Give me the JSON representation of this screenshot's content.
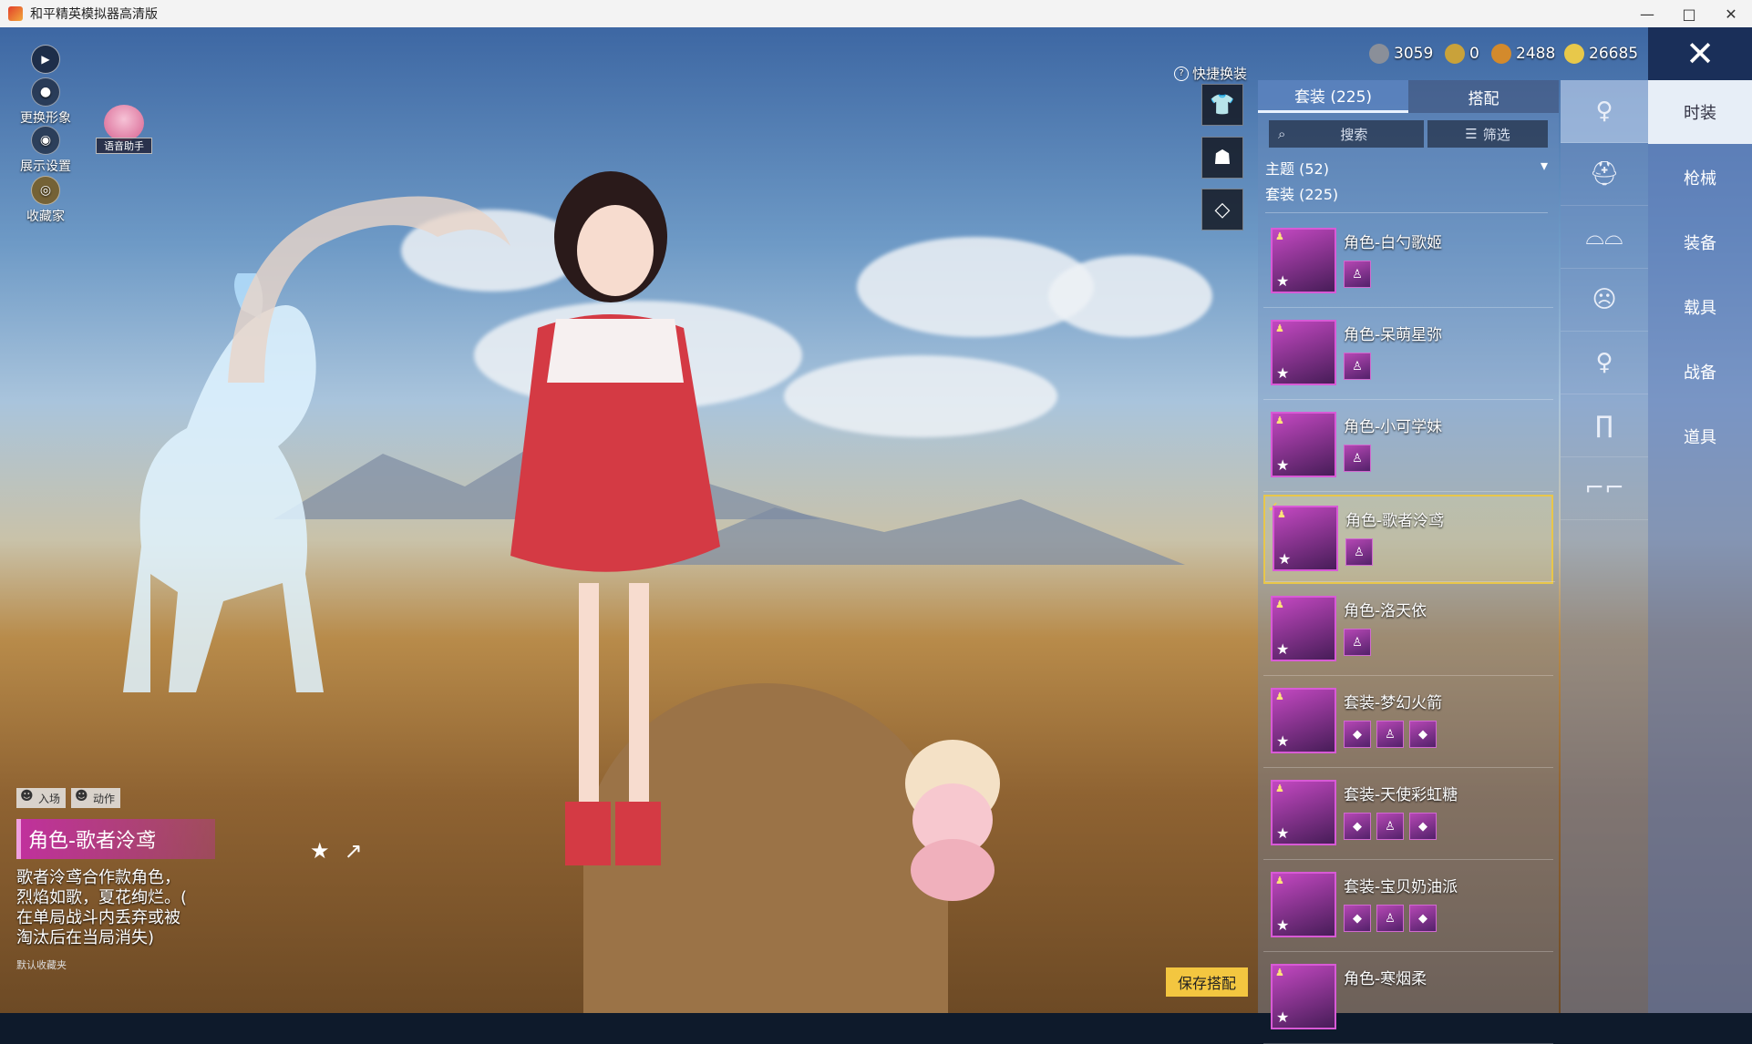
{
  "window": {
    "title": "和平精英模拟器高清版",
    "minimize": "—",
    "maximize": "□",
    "close": "✕"
  },
  "left_menu": {
    "change_look": "更换形象",
    "display_settings": "展示设置",
    "collector": "收藏家",
    "voice_assistant": "语音助手"
  },
  "currencies": [
    {
      "value": "3059",
      "color": "#8a8f99"
    },
    {
      "value": "0",
      "color": "#c9a23a"
    },
    {
      "value": "2488",
      "color": "#d38a2c"
    },
    {
      "value": "26685",
      "color": "#e8c84a"
    }
  ],
  "quick_change": {
    "label": "快捷换装"
  },
  "panel": {
    "tabs": [
      {
        "label": "套装 (225)"
      },
      {
        "label": "搭配"
      }
    ],
    "search": "搜索",
    "filter": "筛选",
    "theme": "主题 (52)",
    "suit_count": "套装 (225)",
    "items": [
      {
        "name": "角色-白勺歌姬",
        "subs": [
          "♙"
        ]
      },
      {
        "name": "角色-呆萌星弥",
        "subs": [
          "♙"
        ]
      },
      {
        "name": "角色-小可学妹",
        "subs": [
          "♙"
        ]
      },
      {
        "name": "角色-歌者泠鸢",
        "subs": [
          "♙"
        ],
        "selected": true
      },
      {
        "name": "角色-洛天依",
        "subs": [
          "♙"
        ]
      },
      {
        "name": "套装-梦幻火箭",
        "subs": [
          "◆",
          "♙",
          "◆"
        ]
      },
      {
        "name": "套装-天使彩虹糖",
        "subs": [
          "◆",
          "♙",
          "◆"
        ]
      },
      {
        "name": "套装-宝贝奶油派",
        "subs": [
          "◆",
          "♙",
          "◆"
        ]
      },
      {
        "name": "角色-寒烟柔",
        "subs": []
      }
    ]
  },
  "categories": [
    "时装",
    "枪械",
    "装备",
    "载具",
    "战备",
    "道具"
  ],
  "bottom_left": {
    "entrance": "入场",
    "action": "动作",
    "role_name": "角色-歌者泠鸢",
    "desc_lines": [
      "歌者泠鸢合作款角色，",
      "烈焰如歌，夏花绚烂。(",
      "在单局战斗内丢弃或被",
      "淘汰后在当局消失)"
    ],
    "fav": "默认收藏夹"
  },
  "save_button": "保存搭配"
}
